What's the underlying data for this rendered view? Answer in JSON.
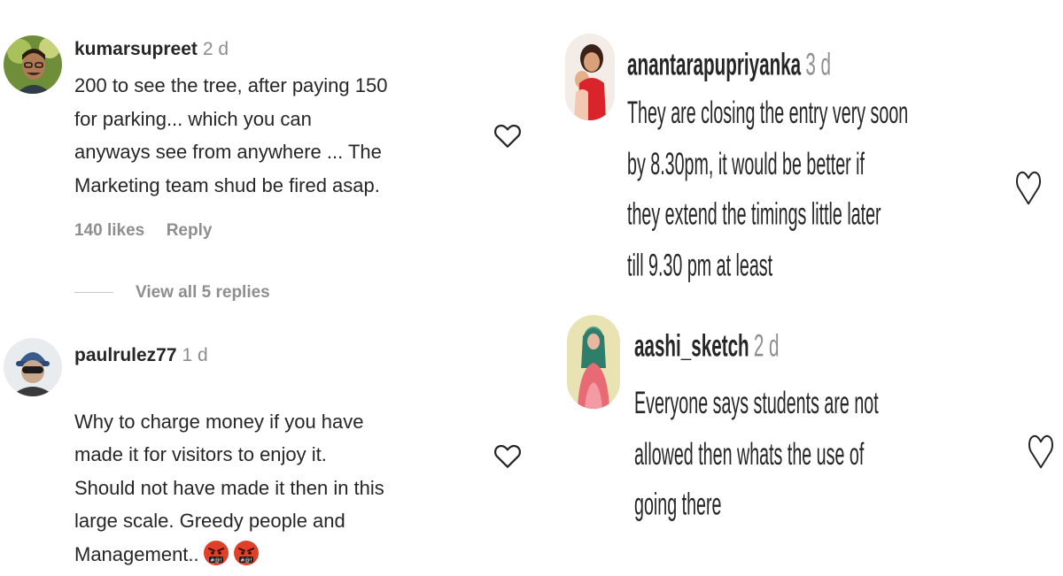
{
  "left_comments": [
    {
      "username": "kumarsupreet",
      "time": "2 d",
      "text": "200 to see the tree, after paying 150\nfor parking... which you can\nanyways see from anywhere ... The\nMarketing team shud be fired asap.",
      "likes": "140 likes",
      "reply": "Reply",
      "view_replies": "View all 5 replies"
    },
    {
      "username": "paulrulez77",
      "time": "1 d",
      "text": "Why to charge money if you have\nmade it for visitors to enjoy it.\nShould not have made it then in this\nlarge scale. Greedy people and\nManagement.."
    }
  ],
  "right_comments": [
    {
      "username": "anantarapupriyanka",
      "time": "3 d",
      "text": "They are closing the entry very soon\nby 8.30pm, it would be better if\nthey extend the timings little later\ntill 9.30 pm at least"
    },
    {
      "username": "aashi_sketch",
      "time": "2 d",
      "text": "Everyone says students are not\nallowed then whats the use of\ngoing there"
    }
  ],
  "icons": {
    "like": "heart-outline-icon",
    "emoji": "angry-swearing-face-icon"
  },
  "colors": {
    "text": "#262626",
    "secondary": "#8e8e8e",
    "emoji": "#e0402a"
  }
}
